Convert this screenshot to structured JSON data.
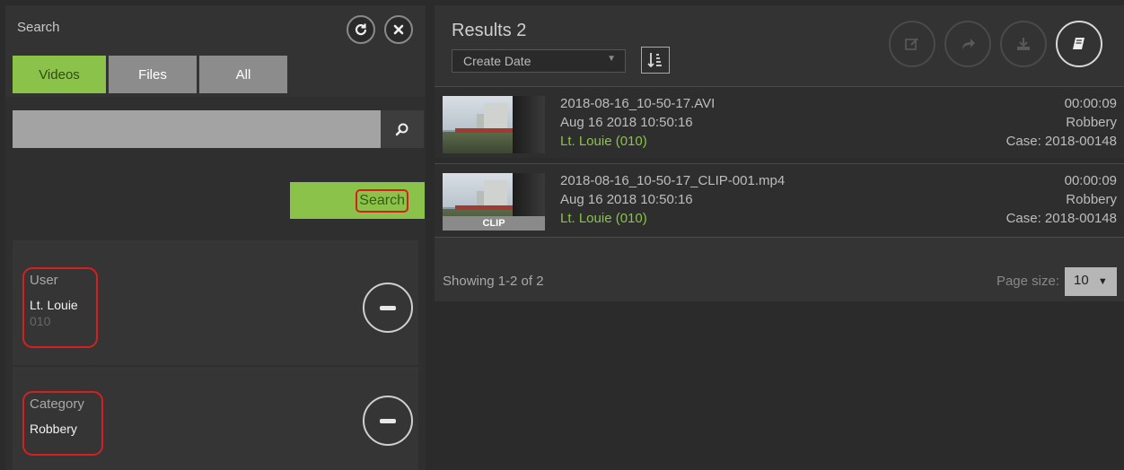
{
  "search_panel": {
    "title": "Search",
    "tabs": [
      {
        "label": "Videos",
        "active": true
      },
      {
        "label": "Files",
        "active": false
      },
      {
        "label": "All",
        "active": false
      }
    ],
    "search_input": {
      "value": "",
      "placeholder": ""
    },
    "search_button_label": "Search",
    "filters": [
      {
        "label": "User",
        "value": "Lt. Louie",
        "sub": "010"
      },
      {
        "label": "Category",
        "value": "Robbery"
      }
    ]
  },
  "results": {
    "title": "Results 2",
    "sort_by": "Create Date",
    "items": [
      {
        "filename": "2018-08-16_10-50-17.AVI",
        "date": "Aug 16 2018 10:50:16",
        "user": "Lt. Louie (010)",
        "duration": "00:00:09",
        "category": "Robbery",
        "case": "Case: 2018-00148",
        "clip_label": ""
      },
      {
        "filename": "2018-08-16_10-50-17_CLIP-001.mp4",
        "date": "Aug 16 2018 10:50:16",
        "user": "Lt. Louie (010)",
        "duration": "00:00:09",
        "category": "Robbery",
        "case": "Case: 2018-00148",
        "clip_label": "CLIP"
      }
    ],
    "showing": "Showing 1-2 of 2",
    "page_size_label": "Page size:",
    "page_size": "10"
  },
  "icons": {
    "refresh": "refresh-icon",
    "close": "close-icon",
    "search": "search-icon",
    "sort_order": "sort-order-icon",
    "edit": "edit-icon",
    "share": "share-icon",
    "download": "download-icon",
    "book": "book-icon"
  },
  "colors": {
    "accent": "#8bc34a",
    "highlight_box": "#d62020"
  }
}
